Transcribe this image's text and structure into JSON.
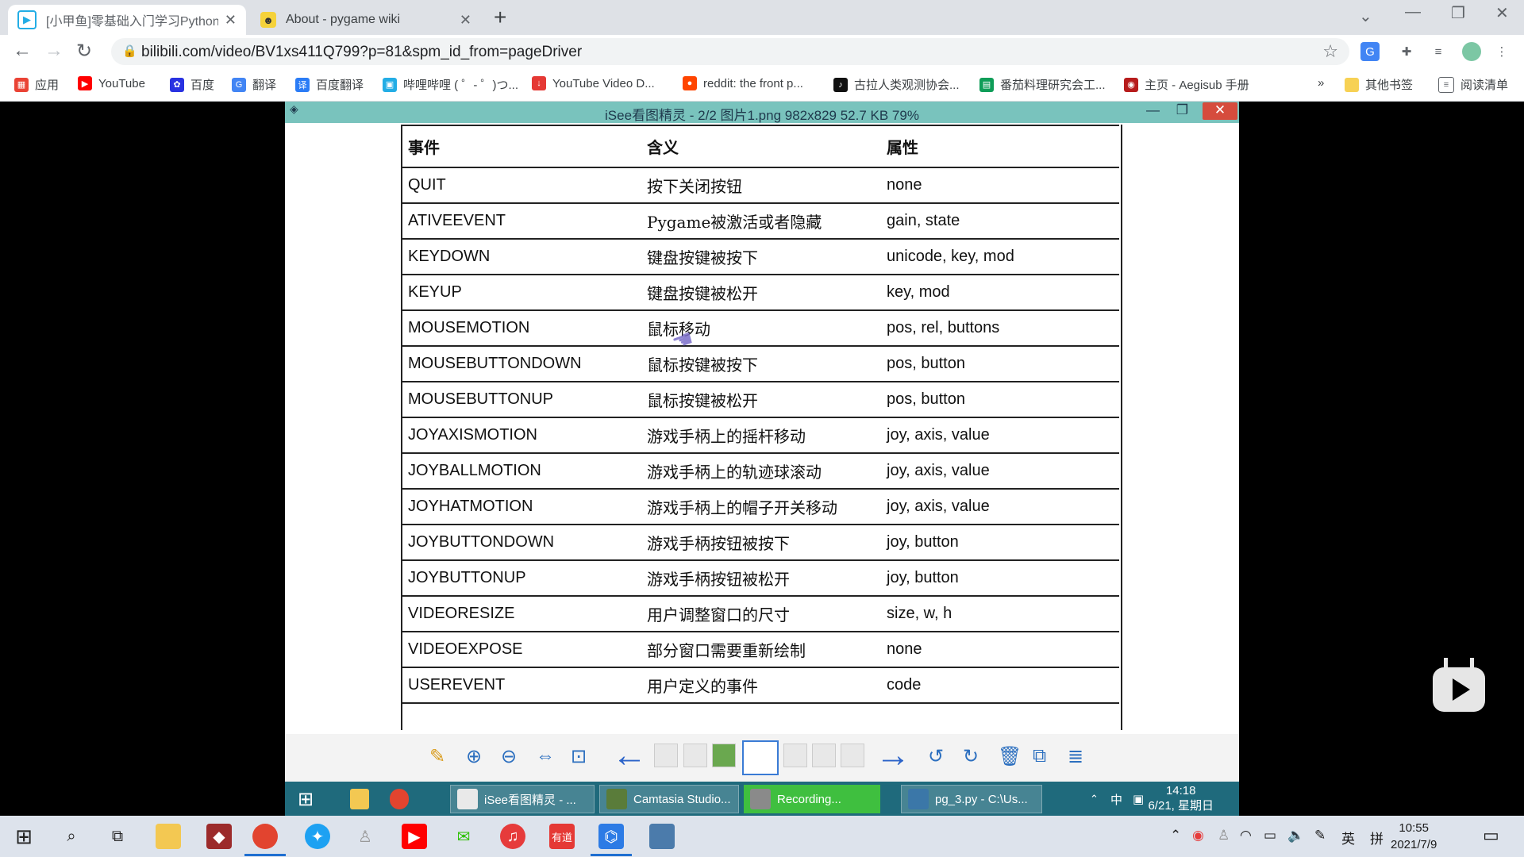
{
  "browser": {
    "tabs": [
      {
        "title": "[小甲鱼]零基础入门学习Python_",
        "icon": "bilibili-icon",
        "active": true
      },
      {
        "title": "About - pygame wiki",
        "icon": "pygame-snake-icon",
        "active": false
      }
    ],
    "url": "bilibili.com/video/BV1xs411Q799?p=81&spm_id_from=pageDriver",
    "bookmarks": [
      {
        "label": "应用",
        "icon": "apps-grid-icon",
        "color": "#ea4335"
      },
      {
        "label": "YouTube",
        "icon": "youtube-icon",
        "color": "#ff0000"
      },
      {
        "label": "百度",
        "icon": "baidu-paw-icon",
        "color": "#2932e1"
      },
      {
        "label": "翻译",
        "icon": "google-translate-icon",
        "color": "#4285f4"
      },
      {
        "label": "百度翻译",
        "icon": "baidu-translate-icon",
        "color": "#2b7cf6"
      },
      {
        "label": "哔哩哔哩 ( ゜- ゜)つ...",
        "icon": "bilibili-icon",
        "color": "#23ade5"
      },
      {
        "label": "YouTube Video D...",
        "icon": "download-icon",
        "color": "#e53935"
      },
      {
        "label": "reddit: the front p...",
        "icon": "reddit-icon",
        "color": "#ff4500"
      },
      {
        "label": "古拉人类观测协会...",
        "icon": "tiktok-icon",
        "color": "#111111"
      },
      {
        "label": "番茄料理研究会工...",
        "icon": "sheets-icon",
        "color": "#0f9d58"
      },
      {
        "label": "主页 - Aegisub 手册",
        "icon": "aegisub-icon",
        "color": "#b71c1c"
      }
    ],
    "bookmarks_more": "»",
    "other_bookmarks": "其他书签",
    "reading_list": "阅读清单"
  },
  "viewer": {
    "title": "iSee看图精灵 - 2/2  图片1.png  982x829  52.7 KB  79%",
    "headers": [
      "事件",
      "含义",
      "属性"
    ],
    "rows": [
      [
        "QUIT",
        "按下关闭按钮",
        "none"
      ],
      [
        "ATIVEEVENT",
        "Pygame被激活或者隐藏",
        "gain, state"
      ],
      [
        "KEYDOWN",
        "键盘按键被按下",
        "unicode, key, mod"
      ],
      [
        "KEYUP",
        "键盘按键被松开",
        "key, mod"
      ],
      [
        "MOUSEMOTION",
        "鼠标移动",
        "pos, rel, buttons"
      ],
      [
        "MOUSEBUTTONDOWN",
        "鼠标按键被按下",
        "pos, button"
      ],
      [
        "MOUSEBUTTONUP",
        "鼠标按键被松开",
        "pos, button"
      ],
      [
        "JOYAXISMOTION",
        "游戏手柄上的摇杆移动",
        "joy, axis, value"
      ],
      [
        "JOYBALLMOTION",
        "游戏手柄上的轨迹球滚动",
        "joy, axis, value"
      ],
      [
        "JOYHATMOTION",
        "游戏手柄上的帽子开关移动",
        "joy, axis, value"
      ],
      [
        "JOYBUTTONDOWN",
        "游戏手柄按钮被按下",
        "joy, button"
      ],
      [
        "JOYBUTTONUP",
        "游戏手柄按钮被松开",
        "joy, button"
      ],
      [
        "VIDEORESIZE",
        "用户调整窗口的尺寸",
        "size, w, h"
      ],
      [
        "VIDEOEXPOSE",
        "部分窗口需要重新绘制",
        "none"
      ],
      [
        "USEREVENT",
        "用户定义的事件",
        "code"
      ]
    ]
  },
  "inner_taskbar": {
    "items": [
      {
        "label": "iSee看图精灵 - ..."
      },
      {
        "label": "Camtasia Studio..."
      },
      {
        "label": "Recording..."
      },
      {
        "label": "pg_3.py - C:\\Us..."
      }
    ],
    "ime": "中",
    "time": "14:18",
    "date": "6/21, 星期日"
  },
  "taskbar": {
    "ime_lang": "英",
    "ime_mode": "拼",
    "time": "10:55",
    "date": "2021/7/9",
    "accent": "#1f6fd1"
  }
}
